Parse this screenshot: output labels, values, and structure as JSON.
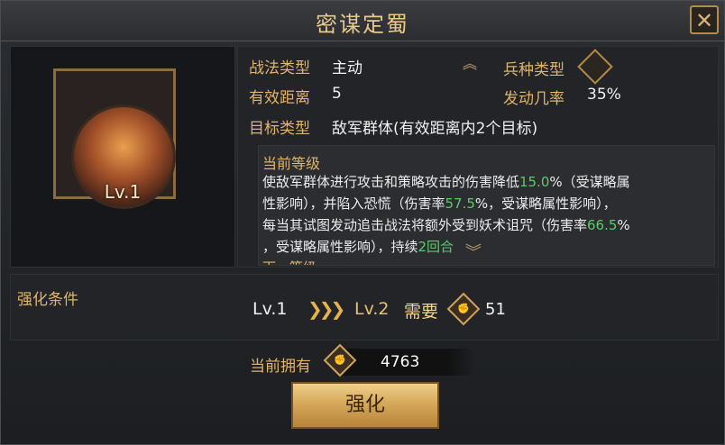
{
  "dialog": {
    "title": "密谋定蜀",
    "close_label": "✕"
  },
  "skill": {
    "level_badge": "Lv.1",
    "type_label": "战法类型",
    "type_value": "主动",
    "troop_label": "兵种类型",
    "range_label": "有效距离",
    "range_value": "5",
    "rate_label": "发动几率",
    "rate_value": "35%",
    "target_label": "目标类型",
    "target_value": "敌军群体(有效距离内2个目标)"
  },
  "description": {
    "current_level_title": "当前等级",
    "line1_a": "使敌军群体进行攻击和策略攻击的伤害降低",
    "line1_hl": "15.0",
    "line1_b": "%（受谋略属",
    "line2_a": "性影响），并陷入恐慌（伤害率",
    "line2_hl": "57.5",
    "line2_b": "%，受谋略属性影响），",
    "line3_a": "每当其试图发动追击战法将额外受到妖术诅咒（伤害率",
    "line3_hl": "66.5",
    "line3_b": "%",
    "line4_a": "，受谋略属性影响），持续",
    "line4_hl": "2回合",
    "next_level_title": "下一等级"
  },
  "upgrade": {
    "condition_label": "强化条件",
    "from_level": "Lv.1",
    "to_level": "Lv.2",
    "need_label": "需要",
    "need_value": "51",
    "own_label": "当前拥有",
    "own_value": "4763",
    "button_label": "强化"
  },
  "colors": {
    "accent_gold": "#e0b46a",
    "highlight_green": "#5ec96b"
  },
  "icons": {
    "close": "close-icon",
    "troop_type": "troop-type-icon",
    "resource": "fist-token-icon",
    "arrows": "triple-chevron-right-icon"
  }
}
